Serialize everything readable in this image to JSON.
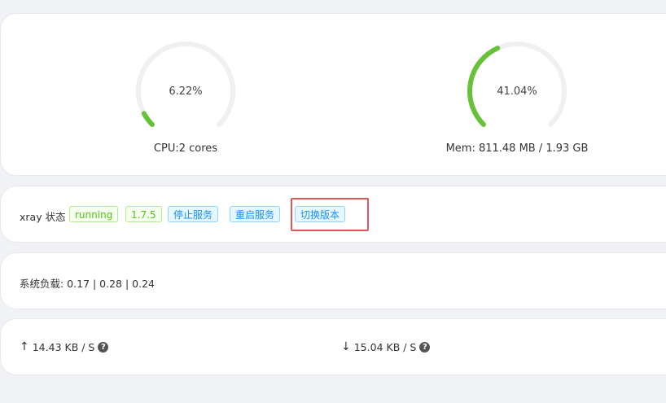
{
  "gauges": {
    "cpu": {
      "percent_label": "6.22%",
      "value": 6.22,
      "caption": "CPU:2 cores",
      "color": "#67c23a"
    },
    "mem": {
      "percent_label": "41.04%",
      "value": 41.04,
      "caption": "Mem: 811.48 MB / 1.93 GB",
      "color": "#67c23a"
    }
  },
  "xray": {
    "label": "xray 状态",
    "status": "running",
    "version": "1.7.5",
    "stop_label": "停止服务",
    "restart_label": "重启服务",
    "switch_label": "切换版本"
  },
  "load": {
    "text": "系统负载: 0.17 | 0.28 | 0.24"
  },
  "network": {
    "up": {
      "arrow": "↑",
      "value": "14.43 KB / S"
    },
    "down": {
      "arrow": "↓",
      "value": "15.04 KB / S"
    },
    "help_glyph": "?"
  },
  "colors": {
    "track": "#f0f0f0",
    "highlight": "#e05558"
  }
}
